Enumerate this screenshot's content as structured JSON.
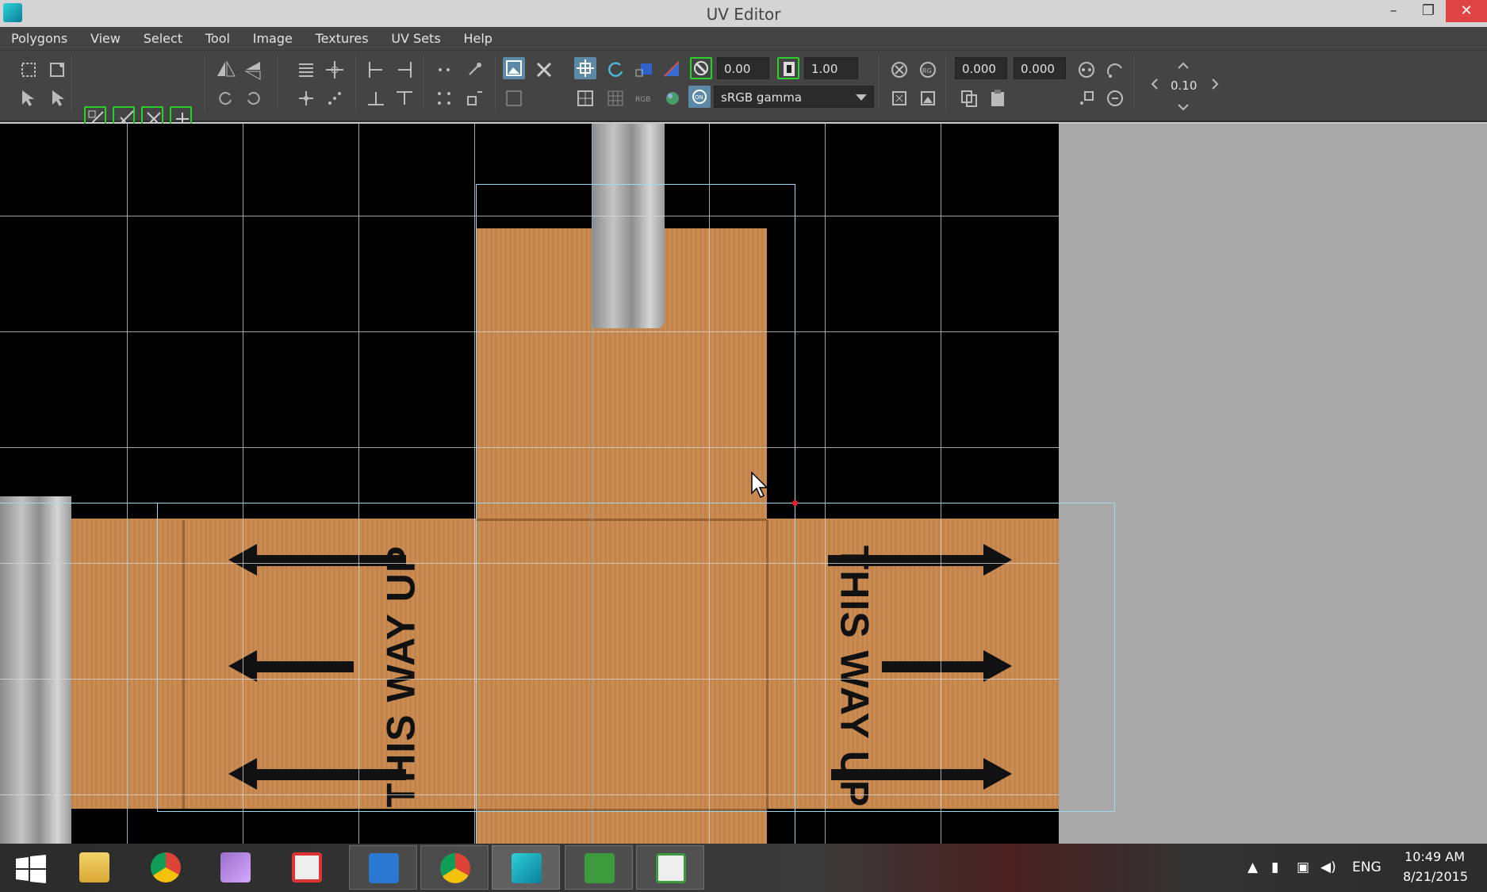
{
  "window": {
    "title": "UV Editor",
    "controls": {
      "minimize": "–",
      "maximize": "❐",
      "close": "✕"
    }
  },
  "menu": [
    "Polygons",
    "View",
    "Select",
    "Tool",
    "Image",
    "Textures",
    "UV Sets",
    "Help"
  ],
  "toolbar": {
    "exposure_value": "0.00",
    "gamma_value": "1.00",
    "color_space": "sRGB gamma",
    "u_value": "0.000",
    "v_value": "0.000",
    "step_value": "0.10"
  },
  "texture": {
    "left_label": "THIS WAY UP",
    "right_label": "THIS WAY UP"
  },
  "taskbar": {
    "apps": [
      "windows-start",
      "file-explorer",
      "chrome",
      "photo-app",
      "camera-app",
      "mail",
      "chrome",
      "maya",
      "camtasia",
      "camtasia-recorder"
    ],
    "tray": {
      "language": "ENG"
    },
    "clock": {
      "time": "10:49 AM",
      "date": "8/21/2015"
    }
  },
  "colors": {
    "cardboard": "#c8884c",
    "uv_shell": "#9fd8ee",
    "active_tool": "#5b89a6",
    "highlight_green": "#2bd12b"
  }
}
